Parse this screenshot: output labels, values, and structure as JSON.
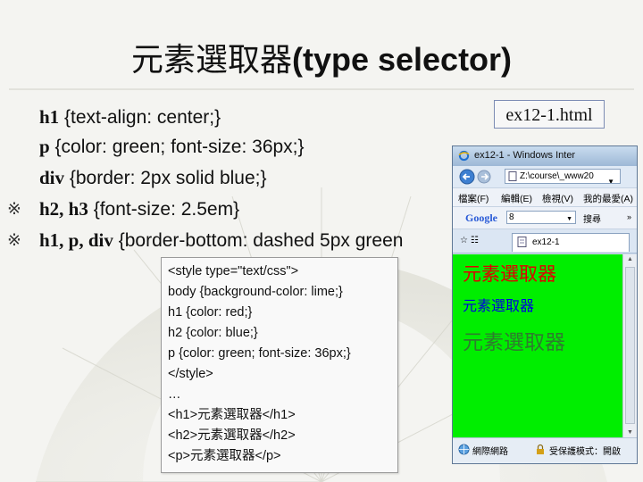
{
  "slide": {
    "title_cjk": "元素選取器",
    "title_en": "(type selector)",
    "file_label": "ex12-1.html",
    "css_lines": [
      {
        "bullet": "",
        "selector": "h1",
        "rule": " {text-align: center;}"
      },
      {
        "bullet": "",
        "selector": "p",
        "rule": " {color: green; font-size: 36px;}"
      },
      {
        "bullet": "",
        "selector": "div",
        "rule": " {border: 2px solid blue;}"
      },
      {
        "bullet": "※",
        "selector": "h2, h3",
        "rule": " {font-size: 2.5em}"
      },
      {
        "bullet": "※",
        "selector": "h1, p, div",
        "rule": " {border-bottom: dashed 5px green"
      }
    ],
    "code_lines": [
      "<style type=\"text/css\">",
      "body {background-color: lime;}",
      "h1 {color: red;}",
      "h2 {color: blue;}",
      "p {color: green; font-size: 36px;}",
      "</style>",
      "…",
      "<h1>元素選取器</h1>",
      "<h2>元素選取器</h2>",
      "<p>元素選取器</p>"
    ]
  },
  "browser": {
    "window_title": "ex12-1 - Windows Inter",
    "address": "Z:\\course\\_www20",
    "menu": [
      "檔案(F)",
      "編輯(E)",
      "檢視(V)",
      "我的最愛(A)"
    ],
    "google_label": "Google",
    "google_value": "8",
    "google_button": "搜尋",
    "tab_title": "ex12-1",
    "content": {
      "h1": "元素選取器",
      "h2": "元素選取器",
      "p": "元素選取器"
    },
    "status_zone": "網際網路",
    "status_mode": "受保護模式：開啟",
    "background_color": "#00ee00",
    "h1_color": "#e00000",
    "h2_color": "#0000e0",
    "p_color": "#2e7d2e"
  }
}
